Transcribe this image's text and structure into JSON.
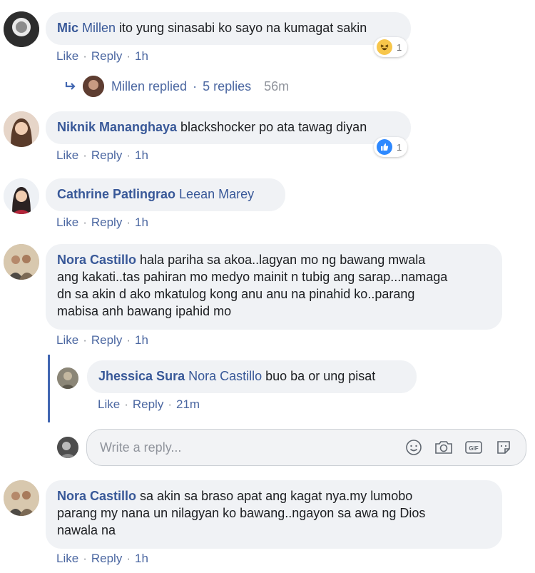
{
  "comments": [
    {
      "author": "Mic",
      "text_mention": "Millen",
      "text": " ito yung sinasabi ko sayo na kumagat sakin",
      "like": "Like",
      "reply": "Reply",
      "time": "1h",
      "reaction_count": "1",
      "reaction_type": "haha-icon"
    },
    {
      "author": "Niknik Mananghaya",
      "text": " blackshocker po ata tawag diyan",
      "like": "Like",
      "reply": "Reply",
      "time": "1h",
      "reaction_count": "1",
      "reaction_type": "like-icon"
    },
    {
      "author": "Cathrine Patlingrao",
      "text_mention": "Leean Marey",
      "like": "Like",
      "reply": "Reply",
      "time": "1h"
    },
    {
      "author": "Nora Castillo",
      "text_lines": [
        " hala pariha sa akoa..lagyan mo ng bawang mwala",
        "ang kakati..tas pahiran mo medyo mainit n tubig ang sarap...namaga",
        "dn sa akin d ako mkatulog kong anu anu na pinahid ko..parang",
        "mabisa anh bawang ipahid mo"
      ],
      "like": "Like",
      "reply": "Reply",
      "time": "1h"
    },
    {
      "author": "Nora Castillo",
      "text_lines": [
        " sa akin sa braso apat ang kagat nya.my lumobo",
        "parang my nana un nilagyan ko bawang..ngayon sa awa ng Dios",
        "nawala na"
      ],
      "like": "Like",
      "reply": "Reply",
      "time": "1h"
    }
  ],
  "replied_summary": {
    "name": "Millen replied",
    "sep": "·",
    "count": "5 replies",
    "time": "56m"
  },
  "nested_reply": {
    "author": "Jhessica Sura",
    "mention": "Nora Castillo",
    "text": " buo ba or ung pisat",
    "like": "Like",
    "reply": "Reply",
    "time": "21m"
  },
  "reply_input": {
    "placeholder": "Write a reply...",
    "icons": [
      "emoji-icon",
      "camera-icon",
      "gif-icon",
      "sticker-icon"
    ]
  },
  "sep": "·",
  "colors": {
    "link": "#385898",
    "bubble": "#f0f2f5",
    "accent": "#4267b2"
  }
}
